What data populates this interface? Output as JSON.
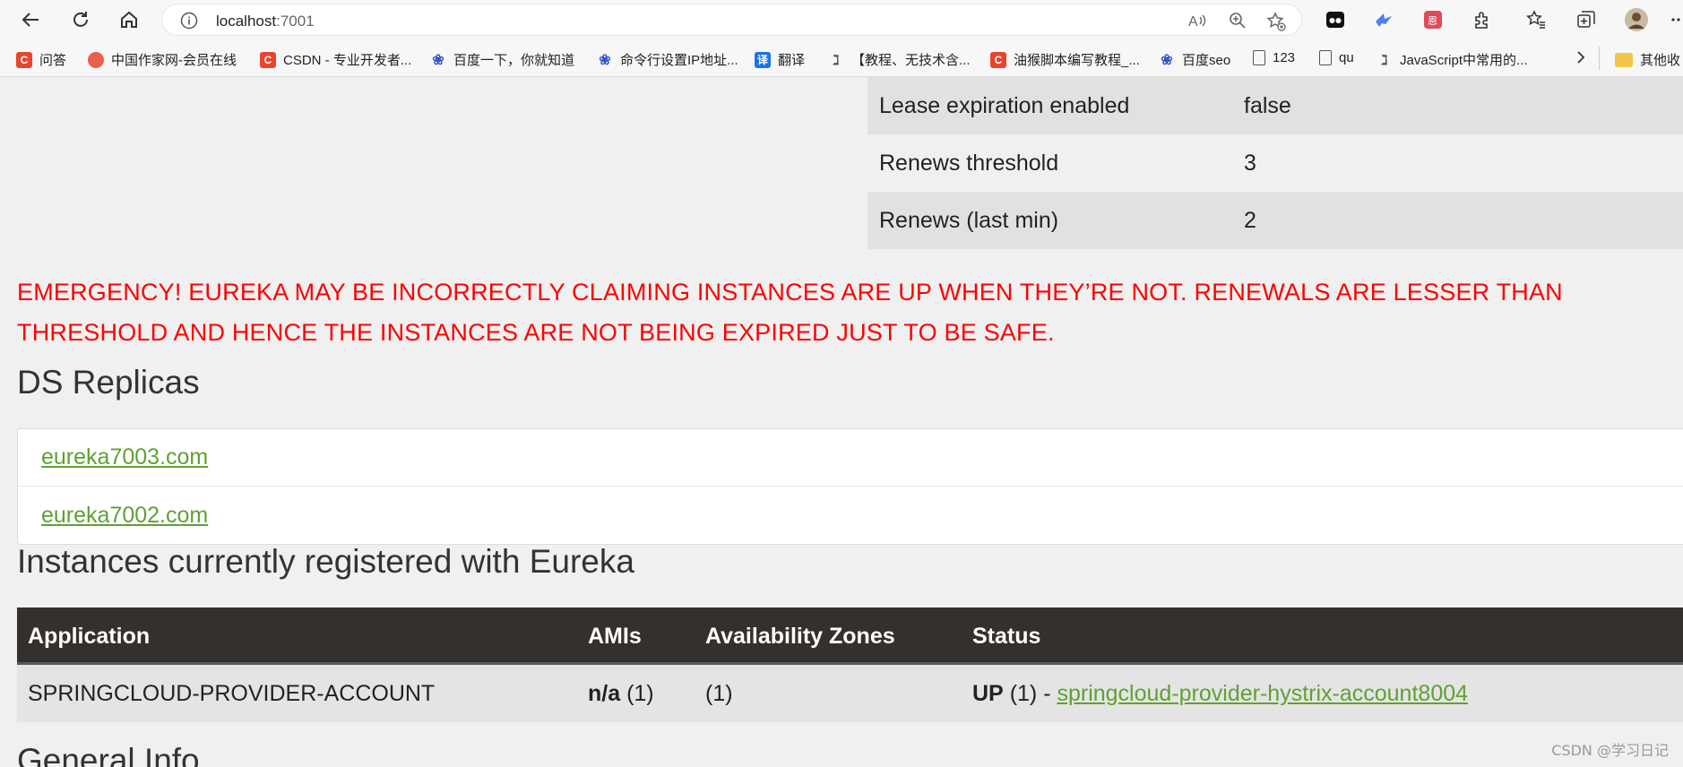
{
  "browser": {
    "url_host": "localhost",
    "url_port": ":7001",
    "bookmarks": [
      {
        "label": "问答",
        "icon": "csdn-c-icon"
      },
      {
        "label": "中国作家网-会员在线",
        "icon": "site-icon"
      },
      {
        "label": "CSDN - 专业开发者...",
        "icon": "csdn-c-icon"
      },
      {
        "label": "百度一下，你就知道",
        "icon": "baidu-paw-icon"
      },
      {
        "label": "命令行设置IP地址...",
        "icon": "baidu-paw-icon"
      },
      {
        "label": "翻译",
        "icon": "translate-icon"
      },
      {
        "label": "【教程、无技术含...",
        "icon": "tampermonkey-icon"
      },
      {
        "label": "油猴脚本编写教程_...",
        "icon": "csdn-c-icon"
      },
      {
        "label": "百度seo",
        "icon": "baidu-paw-icon"
      },
      {
        "label": "123",
        "icon": "file-icon"
      },
      {
        "label": "qu",
        "icon": "file-icon"
      },
      {
        "label": "JavaScript中常用的...",
        "icon": "tampermonkey-icon"
      },
      {
        "label": "其他收",
        "icon": "folder-icon"
      }
    ]
  },
  "status": {
    "rows": [
      {
        "key": "Lease expiration enabled",
        "value": "false"
      },
      {
        "key": "Renews threshold",
        "value": "3"
      },
      {
        "key": "Renews (last min)",
        "value": "2"
      }
    ]
  },
  "emergency": "EMERGENCY! EUREKA MAY BE INCORRECTLY CLAIMING INSTANCES ARE UP WHEN THEY’RE NOT. RENEWALS ARE LESSER THAN THRESHOLD AND HENCE THE INSTANCES ARE NOT BEING EXPIRED JUST TO BE SAFE.",
  "replicas": {
    "title": "DS Replicas",
    "items": [
      "eureka7003.com",
      "eureka7002.com"
    ]
  },
  "instances": {
    "title": "Instances currently registered with Eureka",
    "headers": [
      "Application",
      "AMIs",
      "Availability Zones",
      "Status"
    ],
    "rows": [
      {
        "application": "SPRINGCLOUD-PROVIDER-ACCOUNT",
        "amis_bold": "n/a",
        "amis_count": "(1)",
        "zones": "(1)",
        "status_bold": "UP",
        "status_count": "(1) -",
        "status_link": "springcloud-provider-hystrix-account8004"
      }
    ]
  },
  "general": {
    "title": "General Info"
  },
  "watermark": "CSDN @学习日记",
  "colors": {
    "emergency": "#ff0000",
    "link": "#5fa134",
    "table_header": "#34302d"
  }
}
